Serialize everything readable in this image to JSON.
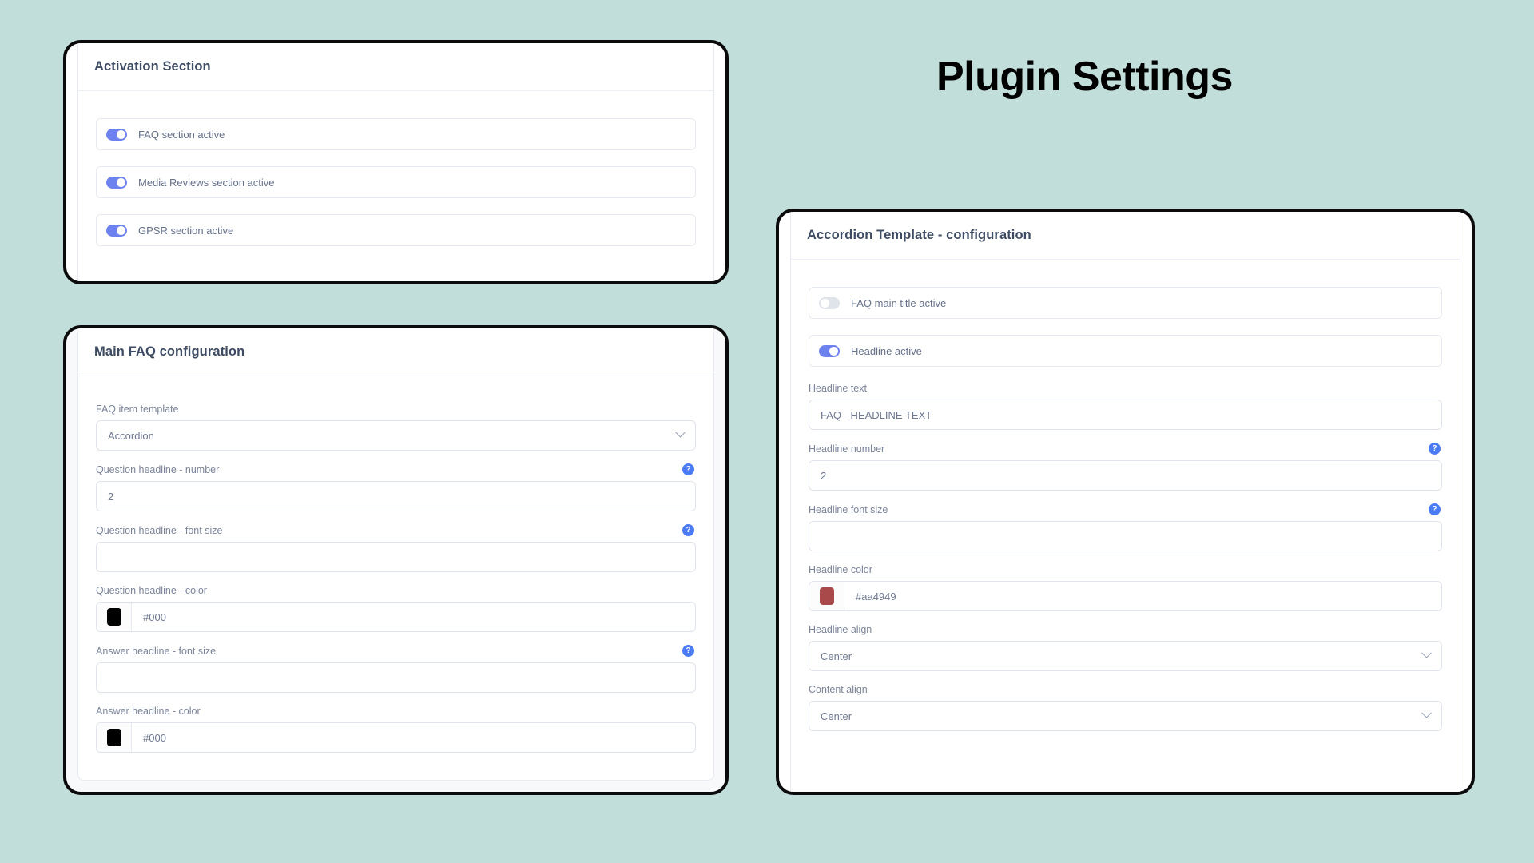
{
  "page": {
    "title": "Plugin Settings",
    "background_color": "#c2dedb"
  },
  "icons": {
    "help": "?",
    "chevron_down": "chevron-down-icon"
  },
  "activation_card": {
    "title": "Activation Section",
    "toggles": [
      {
        "label": "FAQ section active",
        "state": "on"
      },
      {
        "label": "Media Reviews section active",
        "state": "on"
      },
      {
        "label": "GPSR section active",
        "state": "on"
      }
    ]
  },
  "main_faq_card": {
    "title": "Main FAQ configuration",
    "fields": [
      {
        "label": "FAQ item template",
        "type": "select",
        "value": "Accordion",
        "help": false
      },
      {
        "label": "Question headline - number",
        "type": "text",
        "value": "2",
        "help": true
      },
      {
        "label": "Question headline - font size",
        "type": "text",
        "value": "",
        "help": true
      },
      {
        "label": "Question headline - color",
        "type": "color",
        "value": "#000",
        "swatch": "#000000",
        "help": false
      },
      {
        "label": "Answer headline - font size",
        "type": "text",
        "value": "",
        "help": true
      },
      {
        "label": "Answer headline - color",
        "type": "color",
        "value": "#000",
        "swatch": "#000000",
        "help": false
      }
    ]
  },
  "accordion_card": {
    "title": "Accordion Template - configuration",
    "toggles": [
      {
        "label": "FAQ main title active",
        "state": "off"
      },
      {
        "label": "Headline active",
        "state": "on"
      }
    ],
    "fields": [
      {
        "label": "Headline text",
        "type": "text",
        "value": "FAQ  - HEADLINE TEXT",
        "help": false
      },
      {
        "label": "Headline number",
        "type": "text",
        "value": "2",
        "help": true
      },
      {
        "label": "Headline font size",
        "type": "text",
        "value": "",
        "help": true
      },
      {
        "label": "Headline color",
        "type": "color",
        "value": "#aa4949",
        "swatch": "#aa4949",
        "help": false
      },
      {
        "label": "Headline align",
        "type": "select",
        "value": "Center",
        "help": false
      },
      {
        "label": "Content align",
        "type": "select",
        "value": "Center",
        "help": false
      }
    ]
  }
}
